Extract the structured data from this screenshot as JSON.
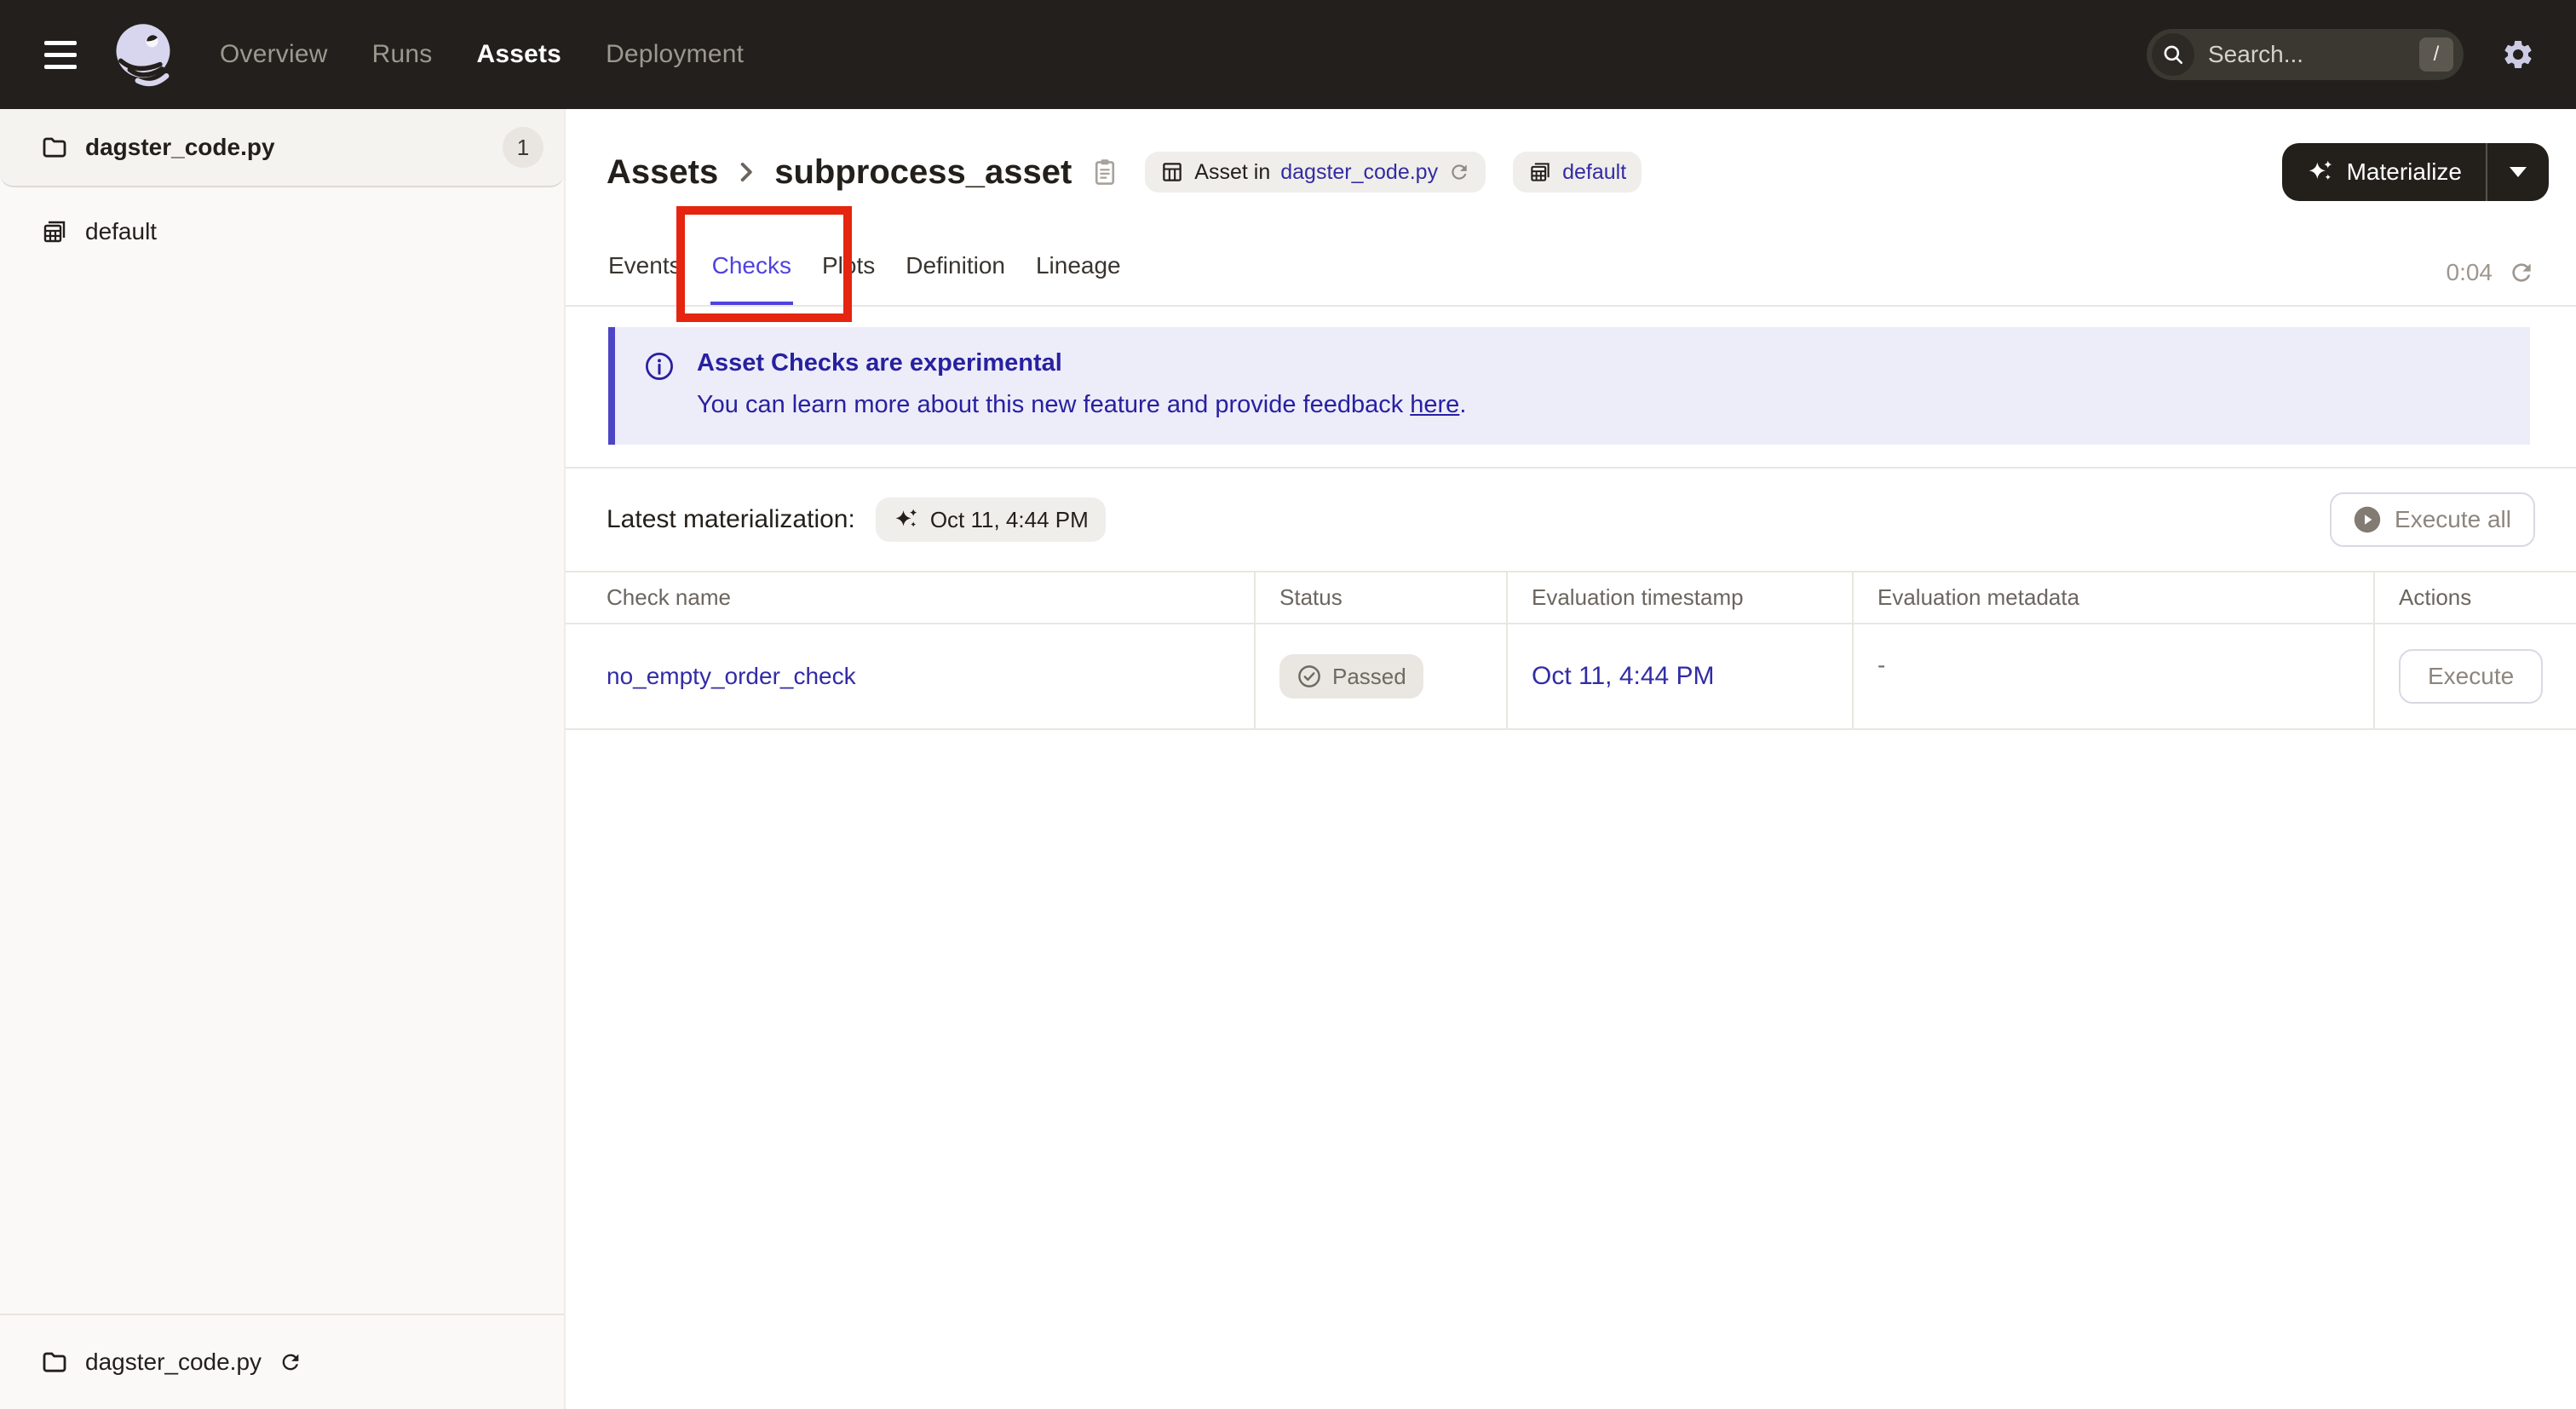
{
  "colors": {
    "topnav_bg": "#221F1C",
    "accent_indigo": "#4F43DD",
    "link": "#322CA5",
    "banner_bg": "#EDECF9",
    "banner_text": "#2721A0",
    "annotation_red": "#E5250F",
    "logo_lavender": "#D8D6EE"
  },
  "topnav": {
    "items": [
      {
        "label": "Overview"
      },
      {
        "label": "Runs"
      },
      {
        "label": "Assets"
      },
      {
        "label": "Deployment"
      }
    ],
    "search": {
      "placeholder": "Search...",
      "shortcut": "/"
    }
  },
  "sidebar": {
    "module": {
      "label": "dagster_code.py",
      "badge": "1"
    },
    "groups": [
      {
        "label": "default"
      }
    ],
    "footer": {
      "label": "dagster_code.py"
    }
  },
  "header": {
    "breadcrumb": {
      "parent": "Assets",
      "current": "subprocess_asset"
    },
    "asset_tag": {
      "prefix": "Asset in",
      "link": "dagster_code.py"
    },
    "group_tag": {
      "label": "default"
    },
    "materialize": {
      "label": "Materialize"
    }
  },
  "tabs": {
    "items": [
      {
        "label": "Events"
      },
      {
        "label": "Checks"
      },
      {
        "label": "Plots"
      },
      {
        "label": "Definition"
      },
      {
        "label": "Lineage"
      }
    ],
    "timer": "0:04"
  },
  "banner": {
    "title": "Asset Checks are experimental",
    "body": "You can learn more about this new feature and provide feedback ",
    "link_text": "here",
    "suffix": "."
  },
  "toolbar": {
    "latest_label": "Latest materialization:",
    "latest_value": "Oct 11, 4:44 PM",
    "execute_all": "Execute all"
  },
  "checks_table": {
    "columns": [
      "Check name",
      "Status",
      "Evaluation timestamp",
      "Evaluation metadata",
      "Actions"
    ],
    "rows": [
      {
        "check_name": "no_empty_order_check",
        "status": "Passed",
        "evaluation_timestamp": "Oct 11, 4:44 PM",
        "evaluation_metadata": "-",
        "action": "Execute"
      }
    ]
  }
}
